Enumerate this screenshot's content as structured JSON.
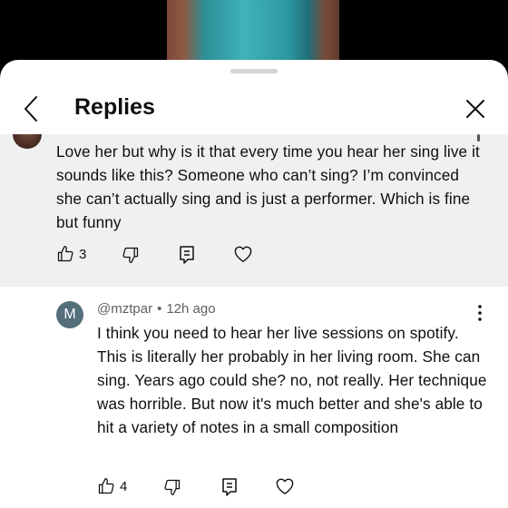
{
  "header": {
    "title": "Replies"
  },
  "parent_comment": {
    "text": "Love her but why is it that every time you hear her sing live it sounds like this? Someone who can’t sing? I’m convinced she can’t actually sing and is just a performer. Which is fine but funny",
    "like_count": "3"
  },
  "reply": {
    "avatar_letter": "M",
    "author": "@mztpar",
    "separator": "•",
    "time": "12h ago",
    "text": "I think you need to hear her live sessions on spotify. This is literally her probably in her living room. She can sing. Years ago could she? no, not really. Her technique was horrible. But now it's much better and she's able to hit a variety of notes in a small composition",
    "like_count": "4"
  },
  "icons": {
    "back": "chevron-left-icon",
    "close": "close-icon",
    "like": "thumbs-up-icon",
    "dislike": "thumbs-down-icon",
    "reply": "reply-comment-icon",
    "heart": "heart-icon",
    "more": "more-vertical-icon"
  },
  "colors": {
    "sheet_bg": "#ffffff",
    "highlight_bg": "#f0f0f0",
    "avatar_bg": "#546e7a",
    "meta_text": "#606060"
  }
}
